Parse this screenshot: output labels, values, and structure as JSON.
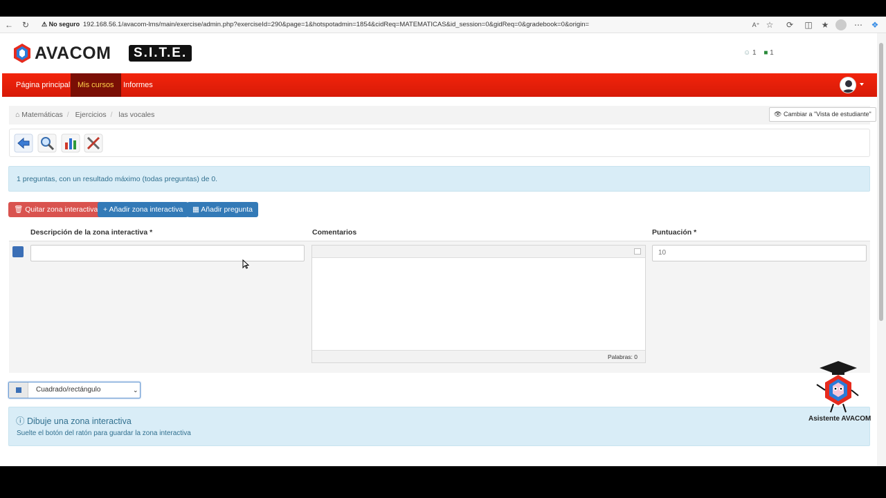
{
  "browser": {
    "security": "No seguro",
    "url": "192.168.56.1/avacom-lms/main/exercise/admin.php?exerciseId=290&page=1&hotspotadmin=1854&cidReq=MATEMATICAS&id_session=0&gidReq=0&gradebook=0&origin="
  },
  "header": {
    "logo_text": "AVACOM",
    "logo_badge": "S.I.T.E.",
    "users_count": "1",
    "groups_count": "1"
  },
  "nav": {
    "items": [
      {
        "label": "Página principal"
      },
      {
        "label": "Mis cursos"
      },
      {
        "label": "Informes"
      }
    ]
  },
  "breadcrumb": {
    "items": [
      "Matemáticas",
      "Ejercicios",
      "las vocales"
    ],
    "student_view_button": "Cambiar a \"Vista de estudiante\""
  },
  "toolbar": {
    "icons": [
      "back-icon",
      "preview-icon",
      "results-icon",
      "settings-icon"
    ]
  },
  "info_message": "1 preguntas, con un resultado máximo (todas preguntas) de 0.",
  "actions": {
    "remove_zone": "Quitar zona interactiva",
    "add_zone": "Añadir zona interactiva",
    "add_question": "Añadir pregunta"
  },
  "table": {
    "headers": {
      "description": "Descripción de la zona interactiva *",
      "comments": "Comentarios",
      "score": "Puntuación *"
    },
    "row": {
      "zone_color": "#3b6fb6",
      "description_value": "",
      "score_value": "10",
      "word_count": "Palabras: 0"
    }
  },
  "shape_select": {
    "selected": "Cuadrado/rectángulo"
  },
  "draw_info": {
    "title": "Dibuje una zona interactiva",
    "subtitle": "Suelte el botón del ratón para guardar la zona interactiva"
  },
  "assistant": {
    "name": "Asistente AVACOM"
  },
  "colors": {
    "nav_red": "#e11f09",
    "nav_active": "#7a0f05",
    "danger": "#d9534f",
    "primary": "#337ab7",
    "info_bg": "#d9edf7",
    "info_text": "#31708f"
  }
}
